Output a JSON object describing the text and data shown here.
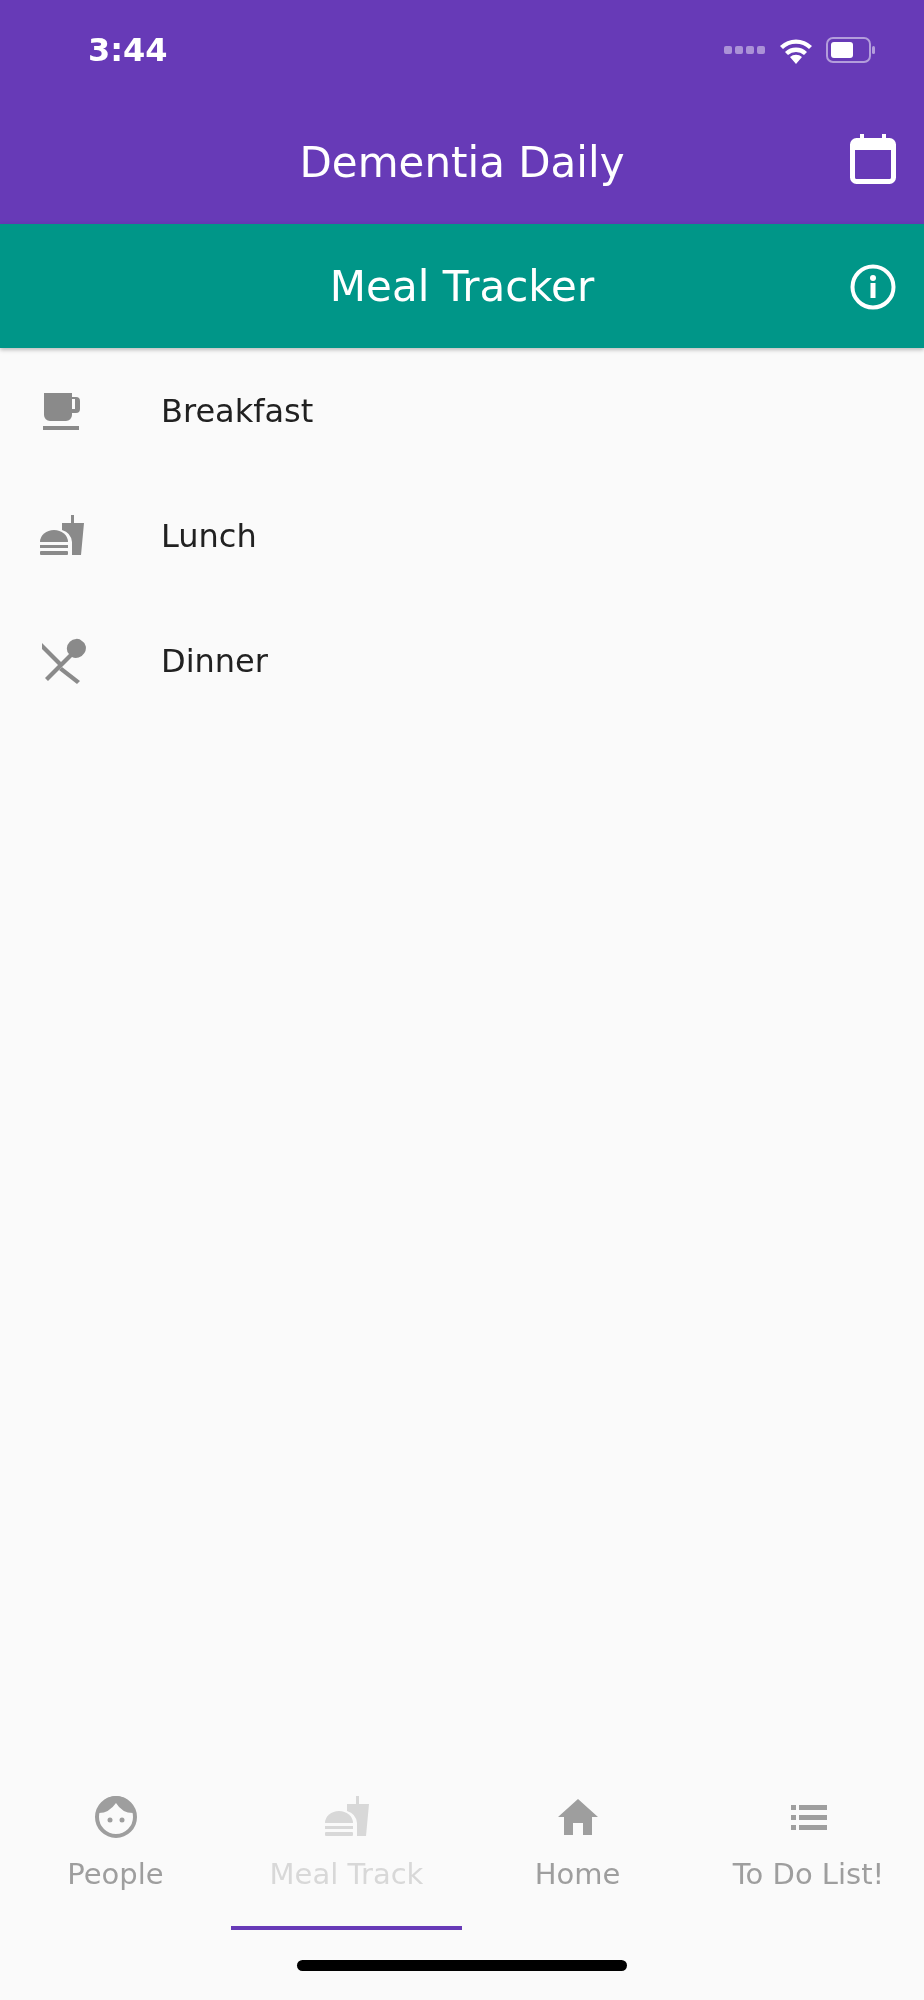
{
  "status_bar": {
    "time": "3:44"
  },
  "app_bar": {
    "title": "Dementia Daily"
  },
  "sub_bar": {
    "title": "Meal Tracker"
  },
  "meals": [
    {
      "label": "Breakfast"
    },
    {
      "label": "Lunch"
    },
    {
      "label": "Dinner"
    }
  ],
  "bottom_tabs": [
    {
      "label": "People",
      "selected": false
    },
    {
      "label": "Meal Track",
      "selected": true
    },
    {
      "label": "Home",
      "selected": false
    },
    {
      "label": "To Do List!",
      "selected": false
    }
  ]
}
